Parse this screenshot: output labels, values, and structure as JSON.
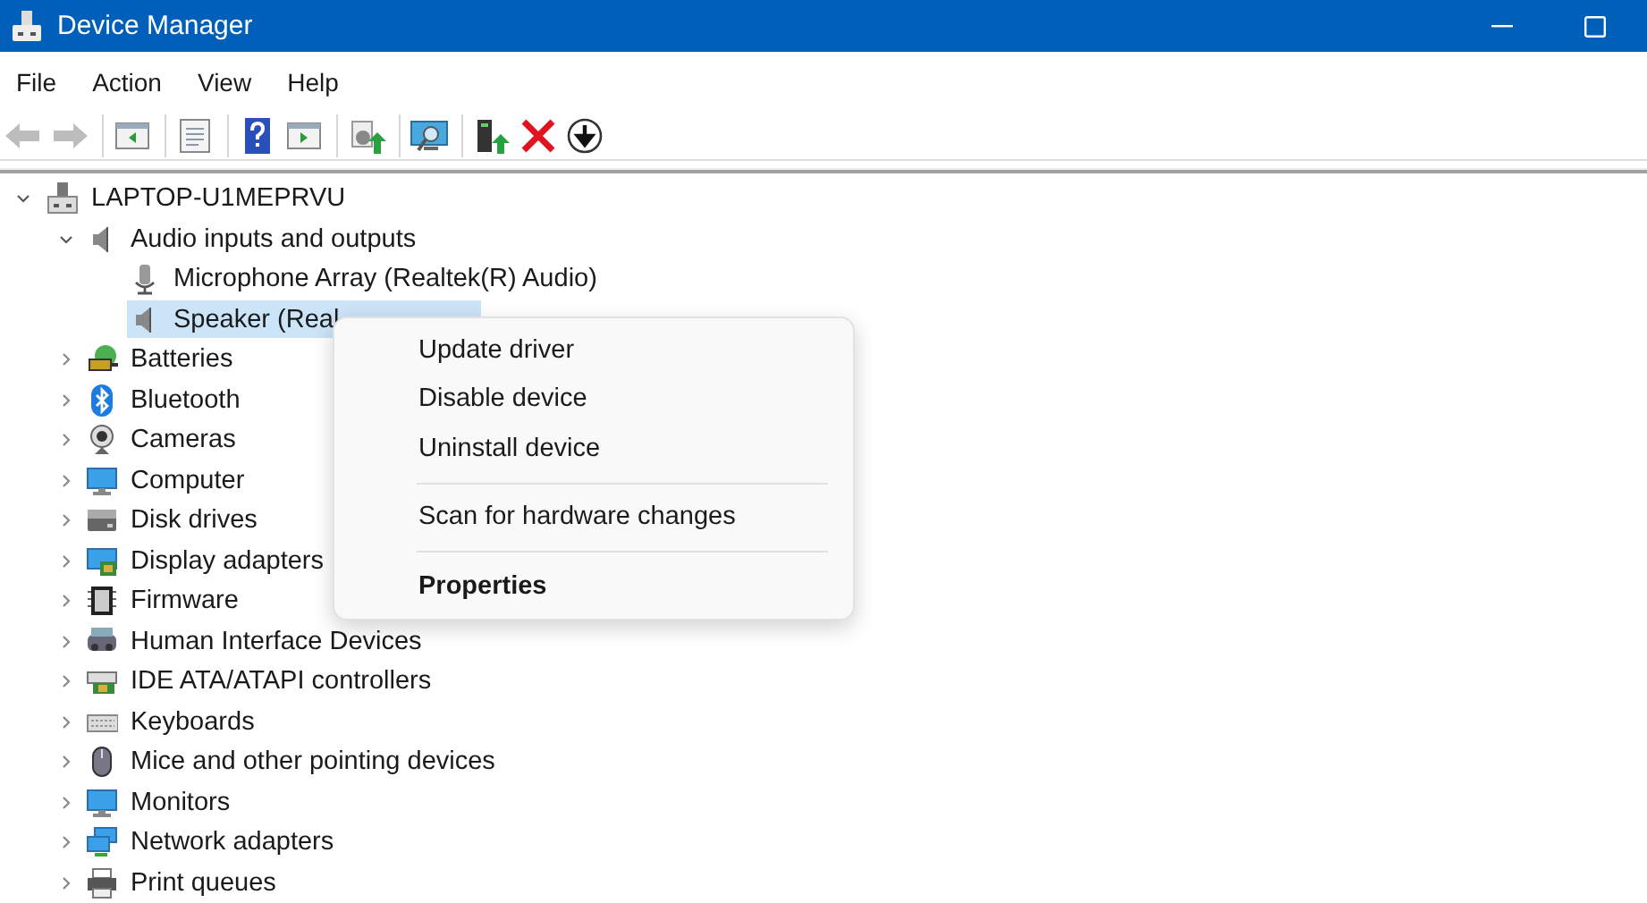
{
  "window": {
    "title": "Device Manager"
  },
  "menu_bar": [
    {
      "label": "File"
    },
    {
      "label": "Action"
    },
    {
      "label": "View"
    },
    {
      "label": "Help"
    }
  ],
  "toolbar": {
    "groups": [
      [
        {
          "kind": "back",
          "disabled": true
        },
        {
          "kind": "forward",
          "disabled": true
        }
      ],
      [
        {
          "kind": "console-tree",
          "disabled": false
        }
      ],
      [
        {
          "kind": "properties",
          "disabled": false
        }
      ],
      [
        {
          "kind": "help",
          "disabled": false
        },
        {
          "kind": "action-pane",
          "disabled": false
        }
      ],
      [
        {
          "kind": "update",
          "disabled": false
        }
      ],
      [
        {
          "kind": "scan",
          "disabled": false
        }
      ],
      [
        {
          "kind": "enable",
          "disabled": false
        },
        {
          "kind": "uninstall",
          "disabled": false
        },
        {
          "kind": "disable",
          "disabled": false
        }
      ]
    ]
  },
  "tree": [
    {
      "label": "LAPTOP-U1MEPRVU",
      "kind": "computer-tower",
      "expanded": true,
      "selected": false,
      "children": [
        {
          "label": "Audio inputs and outputs",
          "kind": "speaker",
          "expanded": true,
          "selected": false,
          "children": [
            {
              "label": "Microphone Array (Realtek(R) Audio)",
              "kind": "microphone",
              "selected": false
            },
            {
              "label": "Speaker (Real",
              "kind": "speaker",
              "selected": true
            }
          ]
        },
        {
          "label": "Batteries",
          "kind": "battery",
          "expanded": false,
          "selected": false
        },
        {
          "label": "Bluetooth",
          "kind": "bluetooth",
          "expanded": false,
          "selected": false
        },
        {
          "label": "Cameras",
          "kind": "camera",
          "expanded": false,
          "selected": false
        },
        {
          "label": "Computer",
          "kind": "monitor",
          "expanded": false,
          "selected": false
        },
        {
          "label": "Disk drives",
          "kind": "disk",
          "expanded": false,
          "selected": false
        },
        {
          "label": "Display adapters",
          "kind": "display-adapter",
          "expanded": false,
          "selected": false
        },
        {
          "label": "Firmware",
          "kind": "chip",
          "expanded": false,
          "selected": false
        },
        {
          "label": "Human Interface Devices",
          "kind": "hid",
          "expanded": false,
          "selected": false
        },
        {
          "label": "IDE ATA/ATAPI controllers",
          "kind": "card",
          "expanded": false,
          "selected": false
        },
        {
          "label": "Keyboards",
          "kind": "keyboard",
          "expanded": false,
          "selected": false
        },
        {
          "label": "Mice and other pointing devices",
          "kind": "mouse",
          "expanded": false,
          "selected": false
        },
        {
          "label": "Monitors",
          "kind": "monitor",
          "expanded": false,
          "selected": false
        },
        {
          "label": "Network adapters",
          "kind": "network",
          "expanded": false,
          "selected": false
        },
        {
          "label": "Print queues",
          "kind": "printer",
          "expanded": false,
          "selected": false
        }
      ]
    }
  ],
  "context_menu": [
    {
      "kind": "item",
      "label": "Update driver",
      "default": false
    },
    {
      "kind": "item",
      "label": "Disable device",
      "default": false
    },
    {
      "kind": "item",
      "label": "Uninstall device",
      "default": false
    },
    {
      "kind": "separator"
    },
    {
      "kind": "item",
      "label": "Scan for hardware changes",
      "default": false
    },
    {
      "kind": "separator"
    },
    {
      "kind": "item",
      "label": "Properties",
      "default": true
    }
  ]
}
